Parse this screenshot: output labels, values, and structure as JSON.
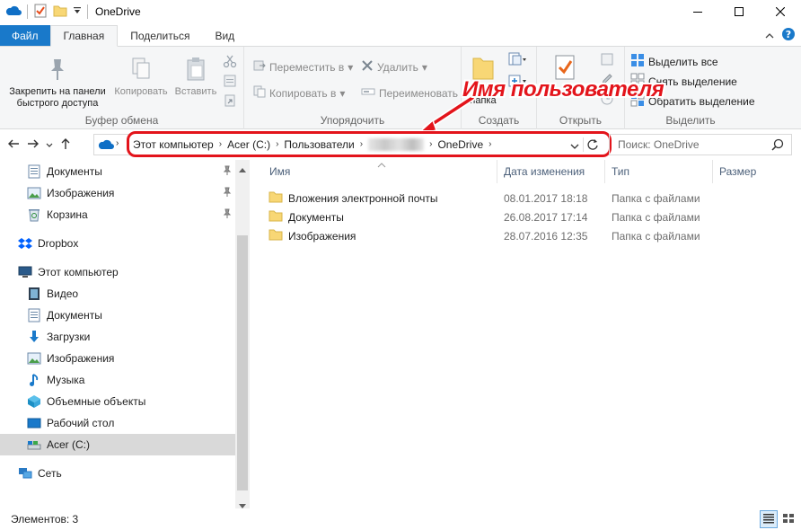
{
  "window": {
    "title": "OneDrive"
  },
  "tabs": {
    "file": "Файл",
    "home": "Главная",
    "share": "Поделиться",
    "view": "Вид"
  },
  "ribbon": {
    "clipboard": {
      "label": "Буфер обмена",
      "pin": "Закрепить на панели быстрого доступа",
      "copy": "Копировать",
      "paste": "Вставить"
    },
    "organize": {
      "label": "Упорядочить",
      "move_to": "Переместить в",
      "copy_to": "Копировать в",
      "delete": "Удалить",
      "rename": "Переименовать"
    },
    "new": {
      "label": "Создать",
      "new_folder": "папка"
    },
    "open": {
      "label": "Открыть"
    },
    "select": {
      "label": "Выделить",
      "select_all": "Выделить все",
      "select_none": "Снять выделение",
      "invert": "Обратить выделение"
    }
  },
  "annotation": {
    "text": "Имя пользователя",
    "color": "#e3141b"
  },
  "address": {
    "crumbs": [
      "Этот компьютер",
      "Acer (C:)",
      "Пользователи",
      "OneDrive"
    ],
    "search_placeholder": "Поиск: OneDrive"
  },
  "nav": {
    "items": [
      {
        "label": "Документы",
        "icon": "documents-icon",
        "pinned": true
      },
      {
        "label": "Изображения",
        "icon": "pictures-icon",
        "pinned": true
      },
      {
        "label": "Корзина",
        "icon": "recycle-bin-icon",
        "pinned": true
      },
      {
        "label": "Dropbox",
        "icon": "dropbox-icon"
      },
      {
        "label": "Этот компьютер",
        "icon": "this-pc-icon"
      },
      {
        "label": "Видео",
        "icon": "videos-icon"
      },
      {
        "label": "Документы",
        "icon": "documents-icon"
      },
      {
        "label": "Загрузки",
        "icon": "downloads-icon"
      },
      {
        "label": "Изображения",
        "icon": "pictures-icon"
      },
      {
        "label": "Музыка",
        "icon": "music-icon"
      },
      {
        "label": "Объемные объекты",
        "icon": "3d-objects-icon"
      },
      {
        "label": "Рабочий стол",
        "icon": "desktop-icon"
      },
      {
        "label": "Acer (C:)",
        "icon": "drive-icon",
        "selected": true
      },
      {
        "label": "Сеть",
        "icon": "network-icon"
      }
    ]
  },
  "columns": {
    "name": "Имя",
    "date": "Дата изменения",
    "type": "Тип",
    "size": "Размер"
  },
  "files": [
    {
      "name": "Вложения электронной почты",
      "date": "08.01.2017 18:18",
      "type": "Папка с файлами"
    },
    {
      "name": "Документы",
      "date": "26.08.2017 17:14",
      "type": "Папка с файлами"
    },
    {
      "name": "Изображения",
      "date": "28.07.2016 12:35",
      "type": "Папка с файлами"
    }
  ],
  "status": {
    "count": "Элементов: 3"
  }
}
